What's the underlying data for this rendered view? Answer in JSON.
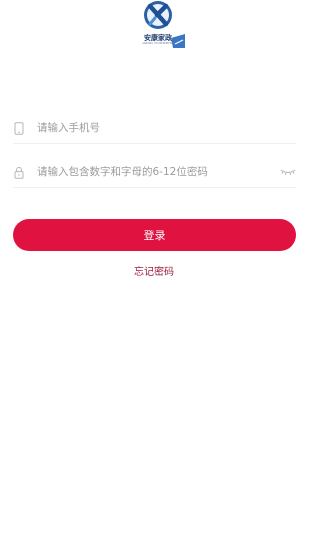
{
  "logo": {
    "name": "安康家政",
    "subtitle": "ANKANG HOUSEKEEPING",
    "icon": "x-letter-logo-icon"
  },
  "form": {
    "phone": {
      "placeholder": "请输入手机号",
      "value": "",
      "icon": "phone-icon"
    },
    "password": {
      "placeholder": "请输入包含数字和字母的6-12位密码",
      "value": "",
      "icon": "lock-icon",
      "toggle_icon": "eye-closed-icon"
    }
  },
  "actions": {
    "login_label": "登录",
    "forgot_label": "忘记密码"
  },
  "colors": {
    "primary": "#e0123f",
    "link": "#9b1c3c",
    "logo_blue": "#1f3a6b"
  }
}
